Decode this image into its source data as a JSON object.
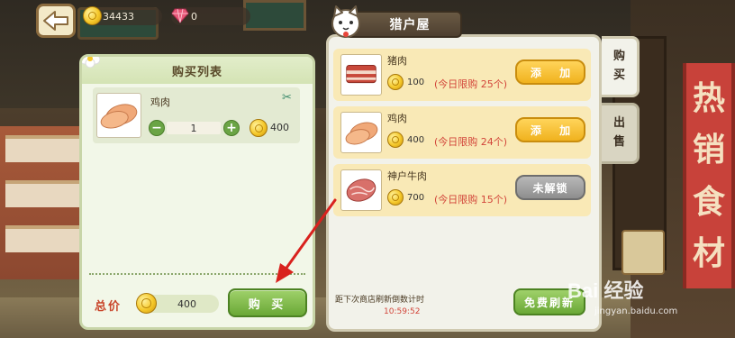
{
  "resources": {
    "coins": "34433",
    "gems": "0"
  },
  "cart": {
    "title": "购买列表",
    "item": {
      "name": "鸡肉",
      "quantity": "1",
      "total": "400"
    },
    "total_label": "总价",
    "total_value": "400",
    "buy_label": "购 买"
  },
  "shop": {
    "title": "猎户屋",
    "items": [
      {
        "name": "猪肉",
        "price": "100",
        "limit": "(今日限购 25个)",
        "action": "添 加"
      },
      {
        "name": "鸡肉",
        "price": "400",
        "limit": "(今日限购 24个)",
        "action": "添 加"
      },
      {
        "name": "神户牛肉",
        "price": "700",
        "limit": "(今日限购 15个)",
        "action": "未解锁"
      }
    ],
    "refresh_label": "距下次商店刷新倒数计时",
    "refresh_timer": "10:59:52",
    "refresh_button": "免费刷新"
  },
  "tabs": {
    "buy": "购买",
    "sell": "出售"
  },
  "banner_chars": [
    "热",
    "销",
    "食",
    "材"
  ],
  "watermark": {
    "text": "Bai 经验",
    "url": "jingyan.baidu.com"
  },
  "colors": {
    "accent_green": "#6aa836",
    "accent_gold": "#f0b21e",
    "limit_red": "#d2453a"
  }
}
